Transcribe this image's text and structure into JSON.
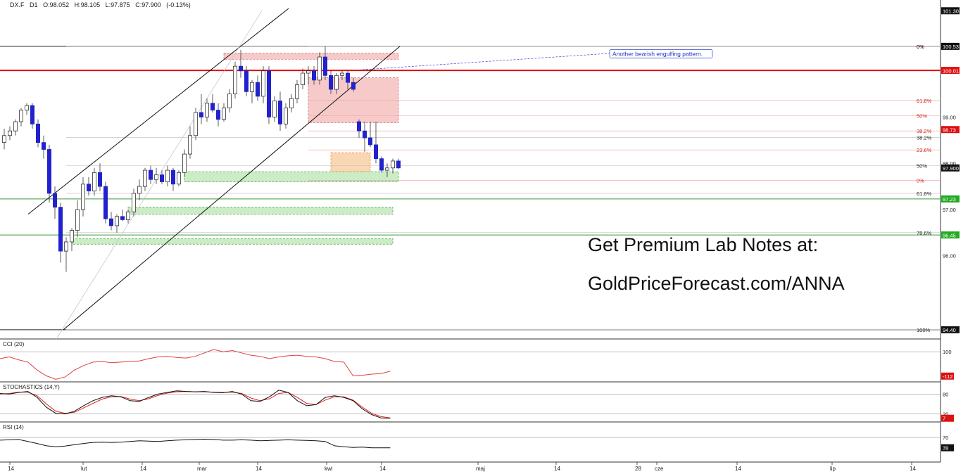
{
  "header": {
    "symbol": "DX.F",
    "timeframe": "D1",
    "open": "O:98.052",
    "high": "H:98.105",
    "low": "L:97.875",
    "close": "C:97.900",
    "change": "(-0.13%)"
  },
  "promo": {
    "line1": "Get Premium Lab Notes at:",
    "line2": "GoldPriceForecast.com/ANNA"
  },
  "annotation": "Another bearish engulfing pattern.",
  "colors": {
    "bull_candle": "#ffffff",
    "bear_candle": "#2222cc",
    "resistance_zone": "#f4b8b8",
    "support_zone": "#b9e5b2",
    "current_zone": "#f8c99a",
    "key_level": "#e00000",
    "cci_line": "#e04040",
    "stoch_k": "#111111",
    "stoch_d": "#e02020",
    "rsi_line": "#111111"
  },
  "chart_data": {
    "type": "candlestick",
    "ylim": [
      94.2,
      101.35
    ],
    "price_axis": {
      "ticks": [
        {
          "value": 101.3,
          "label": "101.30",
          "boxed": "dark"
        },
        {
          "value": 100.53,
          "label": "100.53",
          "boxed": "dark"
        },
        {
          "value": 100.01,
          "label": "100.01",
          "boxed": "red"
        },
        {
          "value": 99.0,
          "label": "99.00"
        },
        {
          "value": 98.73,
          "label": "98.73",
          "boxed": "red"
        },
        {
          "value": 98.0,
          "label": "98.00"
        },
        {
          "value": 97.9,
          "label": "97.900",
          "boxed": "dark"
        },
        {
          "value": 97.23,
          "label": "97.23",
          "boxed": "green"
        },
        {
          "value": 97.0,
          "label": "97.00"
        },
        {
          "value": 96.45,
          "label": "96.45",
          "boxed": "green"
        },
        {
          "value": 96.0,
          "label": "96.00"
        },
        {
          "value": 94.4,
          "label": "94.40",
          "boxed": "dark"
        }
      ]
    },
    "x_axis_labels": [
      "14",
      "lut",
      "14",
      "mar",
      "14",
      "kwi",
      "14",
      "maj",
      "14",
      "28",
      "cze",
      "14",
      "lip",
      "14"
    ],
    "horizontal_levels": [
      {
        "value": 100.53,
        "color": "#222222"
      },
      {
        "value": 100.01,
        "color": "#e00000"
      },
      {
        "value": 97.23,
        "color": "#3a9a3a"
      },
      {
        "value": 96.45,
        "color": "#3a9a3a"
      },
      {
        "value": 94.4,
        "color": "#222222"
      }
    ],
    "fib_upper": [
      {
        "label": "0%",
        "value": 100.53
      },
      {
        "label": "61.8%",
        "value": 99.36
      },
      {
        "label": "50%",
        "value": 99.03
      },
      {
        "label": "38.2%",
        "value": 98.7
      },
      {
        "label": "23.6%",
        "value": 98.29
      },
      {
        "label": "0%",
        "value": 97.63
      }
    ],
    "fib_lower": [
      {
        "label": "0%",
        "value": 100.53
      },
      {
        "label": "38.2%",
        "value": 98.56
      },
      {
        "label": "50%",
        "value": 97.95
      },
      {
        "label": "61.8%",
        "value": 97.35
      },
      {
        "label": "78.6%",
        "value": 96.5
      },
      {
        "label": "100%",
        "value": 94.4
      }
    ],
    "zones": [
      {
        "kind": "resistance",
        "x0": 39,
        "x1": 70,
        "y0": 100.25,
        "y1": 100.38
      },
      {
        "kind": "resistance",
        "x0": 54,
        "x1": 70,
        "y0": 98.88,
        "y1": 99.85
      },
      {
        "kind": "support",
        "x0": 32,
        "x1": 70,
        "y0": 97.6,
        "y1": 97.82
      },
      {
        "kind": "support",
        "x0": 22,
        "x1": 69,
        "y0": 96.9,
        "y1": 97.05
      },
      {
        "kind": "support",
        "x0": 12,
        "x1": 69,
        "y0": 96.25,
        "y1": 96.37
      },
      {
        "kind": "current",
        "x0": 58,
        "x1": 65,
        "y0": 97.82,
        "y1": 98.23
      }
    ],
    "candles": [
      [
        98.45,
        98.75,
        98.3,
        98.6
      ],
      [
        98.6,
        98.8,
        98.5,
        98.7
      ],
      [
        98.7,
        98.95,
        98.6,
        98.9
      ],
      [
        98.9,
        99.2,
        98.8,
        99.15
      ],
      [
        99.15,
        99.3,
        99.05,
        99.25
      ],
      [
        99.25,
        99.3,
        98.75,
        98.85
      ],
      [
        98.85,
        98.95,
        98.35,
        98.45
      ],
      [
        98.45,
        98.6,
        98.1,
        98.3
      ],
      [
        98.3,
        98.4,
        97.15,
        97.35
      ],
      [
        97.35,
        97.5,
        96.8,
        97.05
      ],
      [
        97.05,
        97.15,
        95.85,
        96.1
      ],
      [
        96.1,
        96.4,
        95.65,
        96.3
      ],
      [
        96.3,
        96.6,
        96.1,
        96.55
      ],
      [
        96.55,
        97.2,
        96.4,
        97.0
      ],
      [
        97.0,
        97.7,
        96.85,
        97.55
      ],
      [
        97.55,
        97.7,
        97.3,
        97.4
      ],
      [
        97.4,
        97.9,
        97.3,
        97.8
      ],
      [
        97.8,
        98.0,
        97.4,
        97.5
      ],
      [
        97.5,
        97.6,
        96.7,
        96.8
      ],
      [
        96.8,
        96.95,
        96.55,
        96.65
      ],
      [
        96.65,
        96.9,
        96.5,
        96.85
      ],
      [
        96.85,
        97.0,
        96.75,
        96.78
      ],
      [
        96.78,
        97.0,
        96.7,
        96.95
      ],
      [
        96.95,
        97.45,
        96.85,
        97.35
      ],
      [
        97.35,
        97.65,
        97.2,
        97.5
      ],
      [
        97.5,
        97.9,
        97.4,
        97.85
      ],
      [
        97.85,
        97.95,
        97.55,
        97.65
      ],
      [
        97.65,
        97.9,
        97.55,
        97.75
      ],
      [
        97.75,
        97.85,
        97.55,
        97.6
      ],
      [
        97.6,
        97.95,
        97.5,
        97.85
      ],
      [
        97.85,
        97.9,
        97.4,
        97.55
      ],
      [
        97.55,
        97.85,
        97.5,
        97.8
      ],
      [
        97.8,
        98.3,
        97.7,
        98.2
      ],
      [
        98.2,
        98.8,
        98.1,
        98.6
      ],
      [
        98.6,
        99.2,
        98.5,
        99.1
      ],
      [
        99.1,
        99.5,
        98.85,
        99.0
      ],
      [
        99.0,
        99.4,
        98.9,
        99.3
      ],
      [
        99.3,
        99.5,
        99.1,
        99.15
      ],
      [
        99.15,
        99.3,
        98.8,
        98.95
      ],
      [
        98.95,
        99.3,
        98.9,
        99.2
      ],
      [
        99.2,
        99.6,
        99.1,
        99.5
      ],
      [
        99.5,
        100.2,
        99.4,
        100.1
      ],
      [
        100.1,
        100.45,
        99.85,
        100.0
      ],
      [
        100.0,
        100.1,
        99.45,
        99.55
      ],
      [
        99.55,
        99.8,
        99.3,
        99.75
      ],
      [
        99.75,
        99.9,
        99.35,
        99.45
      ],
      [
        99.45,
        100.1,
        99.3,
        100.0
      ],
      [
        100.0,
        100.1,
        98.85,
        99.0
      ],
      [
        99.0,
        99.45,
        98.9,
        99.35
      ],
      [
        99.35,
        99.55,
        98.7,
        98.85
      ],
      [
        98.85,
        99.3,
        98.75,
        99.2
      ],
      [
        99.2,
        99.5,
        99.1,
        99.4
      ],
      [
        99.4,
        99.8,
        99.3,
        99.7
      ],
      [
        99.7,
        100.05,
        99.6,
        99.95
      ],
      [
        99.95,
        100.1,
        99.7,
        100.0
      ],
      [
        100.0,
        100.1,
        99.7,
        99.8
      ],
      [
        99.8,
        100.4,
        99.7,
        100.3
      ],
      [
        100.3,
        100.53,
        99.8,
        99.9
      ],
      [
        99.9,
        100.0,
        99.5,
        99.6
      ],
      [
        99.6,
        99.95,
        99.5,
        99.9
      ],
      [
        99.9,
        100.0,
        99.8,
        99.95
      ],
      [
        99.95,
        100.0,
        99.6,
        99.75
      ],
      [
        99.75,
        99.85,
        99.55,
        99.6
      ],
      [
        98.9,
        98.95,
        98.55,
        98.7
      ],
      [
        98.7,
        98.9,
        98.25,
        98.55
      ],
      [
        98.55,
        98.9,
        98.35,
        98.4
      ],
      [
        98.4,
        98.9,
        98.0,
        98.1
      ],
      [
        98.1,
        98.15,
        97.8,
        97.85
      ],
      [
        97.85,
        98.0,
        97.7,
        97.9
      ],
      [
        97.9,
        98.1,
        97.78,
        98.05
      ],
      [
        98.05,
        98.1,
        97.875,
        97.9
      ]
    ],
    "indicators": [
      {
        "name": "CCI (20)",
        "ticks": [
          {
            "label": "100"
          },
          {
            "label": "-112",
            "boxed": "red"
          }
        ],
        "values": [
          40,
          55,
          30,
          10,
          -60,
          -110,
          -140,
          -120,
          -60,
          -20,
          10,
          15,
          5,
          10,
          15,
          20,
          40,
          55,
          60,
          50,
          45,
          60,
          90,
          120,
          100,
          110,
          90,
          70,
          60,
          40,
          55,
          65,
          70,
          60,
          55,
          40,
          15,
          10,
          -110,
          -105,
          -95,
          -90,
          -70
        ]
      },
      {
        "name": "STOCHASTICS (14,Y)",
        "ticks": [
          {
            "label": "80"
          },
          {
            "label": "20"
          },
          {
            "label": "7",
            "boxed": "red"
          }
        ],
        "k": [
          82,
          80,
          85,
          88,
          70,
          40,
          22,
          20,
          28,
          45,
          60,
          70,
          75,
          72,
          60,
          58,
          70,
          80,
          85,
          90,
          88,
          87,
          88,
          85,
          84,
          88,
          80,
          60,
          58,
          72,
          92,
          85,
          60,
          45,
          48,
          70,
          75,
          70,
          60,
          35,
          18,
          8,
          7
        ],
        "d": [
          80,
          82,
          86,
          86,
          75,
          50,
          28,
          22,
          25,
          38,
          52,
          65,
          72,
          73,
          65,
          60,
          66,
          76,
          83,
          87,
          88,
          87,
          87,
          86,
          85,
          86,
          82,
          68,
          60,
          66,
          82,
          85,
          70,
          52,
          48,
          62,
          72,
          72,
          62,
          40,
          22,
          12,
          8
        ]
      },
      {
        "name": "RSI (14)",
        "ticks": [
          {
            "label": "70"
          },
          {
            "label": "39",
            "boxed": "dark"
          }
        ],
        "values": [
          62,
          63,
          64,
          58,
          52,
          45,
          42,
          44,
          48,
          52,
          55,
          56,
          55,
          56,
          58,
          60,
          59,
          58,
          60,
          62,
          63,
          64,
          65,
          64,
          62,
          62,
          63,
          62,
          60,
          61,
          62,
          63,
          62,
          61,
          60,
          58,
          45,
          42,
          40,
          41,
          39,
          39,
          39
        ]
      }
    ]
  }
}
